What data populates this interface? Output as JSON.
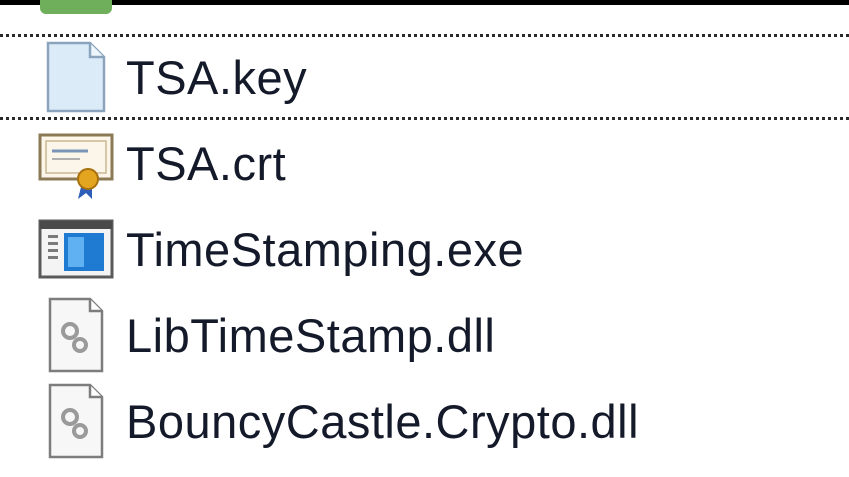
{
  "partial_item": {
    "label": "..."
  },
  "files": [
    {
      "name": "TSA.key",
      "icon": "key-file-icon",
      "selected": true
    },
    {
      "name": "TSA.crt",
      "icon": "certificate-icon",
      "selected": false
    },
    {
      "name": "TimeStamping.exe",
      "icon": "exe-icon",
      "selected": false
    },
    {
      "name": "LibTimeStamp.dll",
      "icon": "dll-icon",
      "selected": false
    },
    {
      "name": "BouncyCastle.Crypto.dll",
      "icon": "dll-icon",
      "selected": false
    }
  ],
  "colors": {
    "text": "#141a2a",
    "selection_border": "#2b2b2b",
    "cert_ribbon": "#d9a520",
    "exe_blue": "#1f7ad1"
  }
}
